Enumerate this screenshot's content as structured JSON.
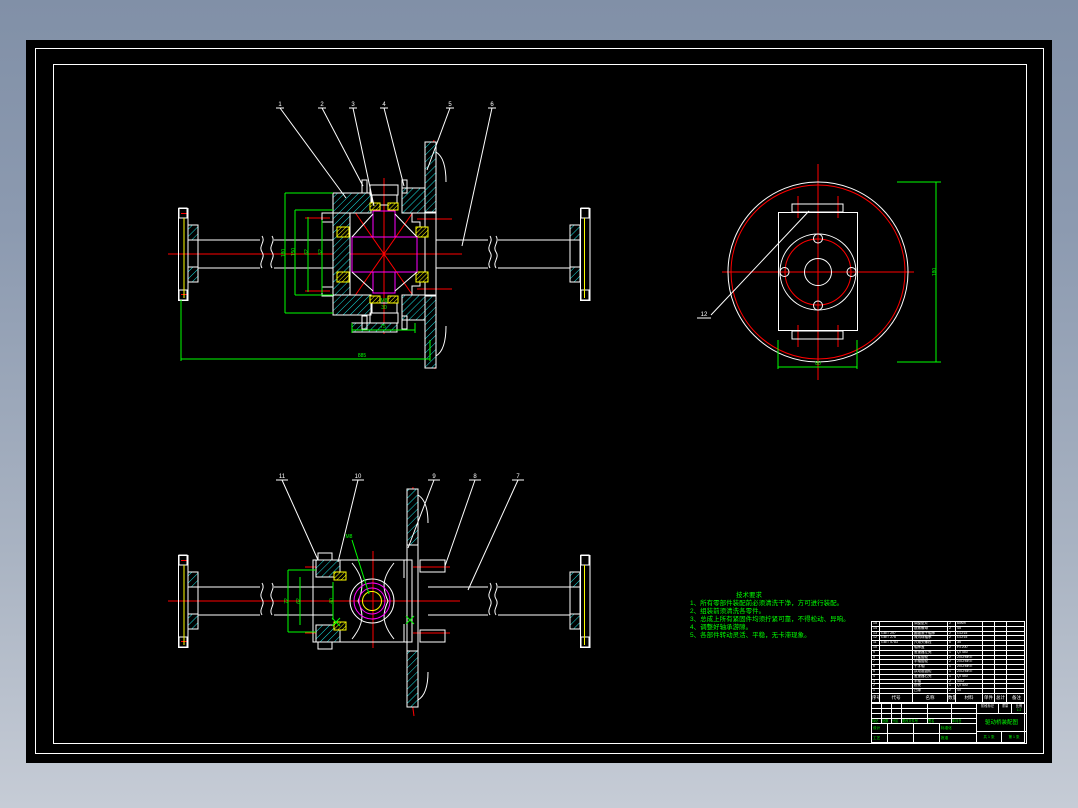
{
  "frame": {
    "canvas_color": "#000000",
    "line_color": "#ffffff",
    "bg_top": "#8190a7",
    "bg_bottom": "#c6ccd6"
  },
  "palette": {
    "hatch": "#19e0e0",
    "dimension": "#00ff00",
    "centerline": "#ff0000",
    "detail": "#ff00ff",
    "bearing": "#ffff00",
    "white": "#ffffff"
  },
  "view_front": {
    "balloons": [
      "1",
      "2",
      "3",
      "4",
      "5",
      "6"
    ],
    "dims": {
      "d1": "180",
      "d2": "150",
      "d3": "62",
      "d4": "52",
      "width": "75",
      "overall": "885",
      "thread": "M8",
      "bore": "30"
    }
  },
  "view_rear": {
    "balloon": "12",
    "dims": {
      "height": "180",
      "width": "80"
    }
  },
  "view_top": {
    "balloons": [
      "11",
      "10",
      "9",
      "8",
      "7"
    ],
    "dims": {
      "a": "72",
      "b": "62",
      "c": "40",
      "leader": "M8"
    }
  },
  "notes": {
    "title": "技术要求",
    "lines": [
      "1、所有零部件装配前必须清洗干净，方可进行装配。",
      "2、组装前须清洗各零件。",
      "3、总成上所有紧固件均须拧紧可靠，不得松动、异响。",
      "4、调整好轴承游隙。",
      "5、各部件转动灵活、平稳，无卡滞现象。"
    ]
  },
  "bom": {
    "headers": [
      "序号",
      "代号",
      "名称",
      "数量",
      "材料",
      "单件",
      "总计",
      "备注"
    ],
    "rows": [
      [
        "15",
        "",
        "调整垫片",
        "2",
        "65Mn",
        "",
        "",
        ""
      ],
      [
        "14",
        "",
        "锁紧螺母",
        "2",
        "45",
        "",
        "",
        ""
      ],
      [
        "13",
        "GB/T 297",
        "圆锥滚子轴承",
        "2",
        "GCr15",
        "",
        "",
        ""
      ],
      [
        "12",
        "GB/T 276",
        "深沟球轴承",
        "2",
        "GCr15",
        "",
        "",
        ""
      ],
      [
        "11",
        "GB/T 5783",
        "六角头螺栓",
        "8",
        "35",
        "",
        "",
        ""
      ],
      [
        "10",
        "",
        "轴承盖",
        "2",
        "HT200",
        "",
        "",
        ""
      ],
      [
        "9",
        "",
        "差速器左壳",
        "1",
        "QT450",
        "",
        "",
        ""
      ],
      [
        "8",
        "",
        "行星齿轮",
        "2",
        "20CrMnTi",
        "",
        "",
        ""
      ],
      [
        "7",
        "",
        "半轴齿轮",
        "2",
        "20CrMnTi",
        "",
        "",
        ""
      ],
      [
        "6",
        "",
        "十字轴",
        "1",
        "20CrMnTi",
        "",
        "",
        ""
      ],
      [
        "5",
        "",
        "从动锥齿轮",
        "1",
        "20CrMnTi",
        "",
        "",
        ""
      ],
      [
        "4",
        "",
        "差速器右壳",
        "1",
        "QT450",
        "",
        "",
        ""
      ],
      [
        "3",
        "",
        "半轴",
        "2",
        "40Cr",
        "",
        "",
        ""
      ],
      [
        "2",
        "",
        "桥壳",
        "1",
        "QT400",
        "",
        "",
        ""
      ],
      [
        "1",
        "",
        "凸缘",
        "2",
        "45",
        "",
        "",
        ""
      ]
    ]
  },
  "titleblock": {
    "revision_labels": [
      "标记",
      "处数",
      "分区",
      "更改文件号",
      "签名",
      "年月日"
    ],
    "sign_rows": [
      [
        "设计",
        "标准化"
      ],
      [
        "工艺",
        "批准"
      ]
    ],
    "stage_label": "阶段标记",
    "weight_label": "重量",
    "scale_label": "比例",
    "scale_value": "1:2",
    "title": "驱动桥装配图",
    "sheet": "共 1 张",
    "page": "第 1 张"
  }
}
